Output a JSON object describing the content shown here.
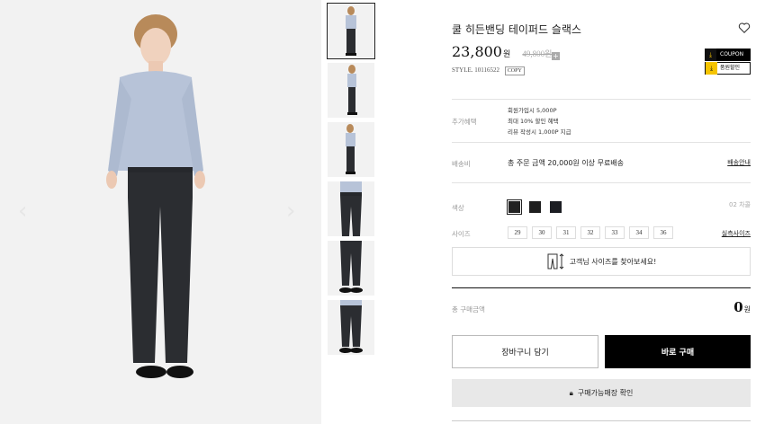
{
  "product": {
    "title": "쿨 히든밴딩 테이퍼드 슬랙스",
    "price": "23,800",
    "currency_unit": "원",
    "original_price": "49,800원",
    "style_label": "STYLE. 10116522",
    "copy_label": "COPY"
  },
  "badges": {
    "coupon": "COUPON",
    "discount": "품원할인"
  },
  "benefits": {
    "label": "추가혜택",
    "lines": [
      "회원가입시 5,000P",
      "최대 10% 할인 혜택",
      "리뷰 작성시 1,000P 지급"
    ]
  },
  "shipping": {
    "label": "배송비",
    "text": "총 주문 금액 20,000원 이상 무료배송",
    "link": "배송안내"
  },
  "color": {
    "label": "색상",
    "selected_name": "02 차콜",
    "swatches": [
      "#222222",
      "#1e1e1e",
      "#1b1d22"
    ]
  },
  "size": {
    "label": "사이즈",
    "options": [
      "29",
      "30",
      "31",
      "32",
      "33",
      "34",
      "36"
    ],
    "guide_link": "실측사이즈"
  },
  "size_finder": {
    "text": "고객님 사이즈를 찾아보세요!"
  },
  "total": {
    "label": "총 구매금액",
    "value": "0",
    "unit": "원"
  },
  "actions": {
    "cart": "장바구니 담기",
    "buy": "바로 구매",
    "store": "구매가능매장 확인"
  },
  "icons": {
    "heart": "heart-icon",
    "plus": "plus-icon",
    "download": "download-icon",
    "size-finder": "pants-size-icon",
    "lock": "lock-icon",
    "prev": "chevron-left-icon",
    "next": "chevron-right-icon"
  }
}
